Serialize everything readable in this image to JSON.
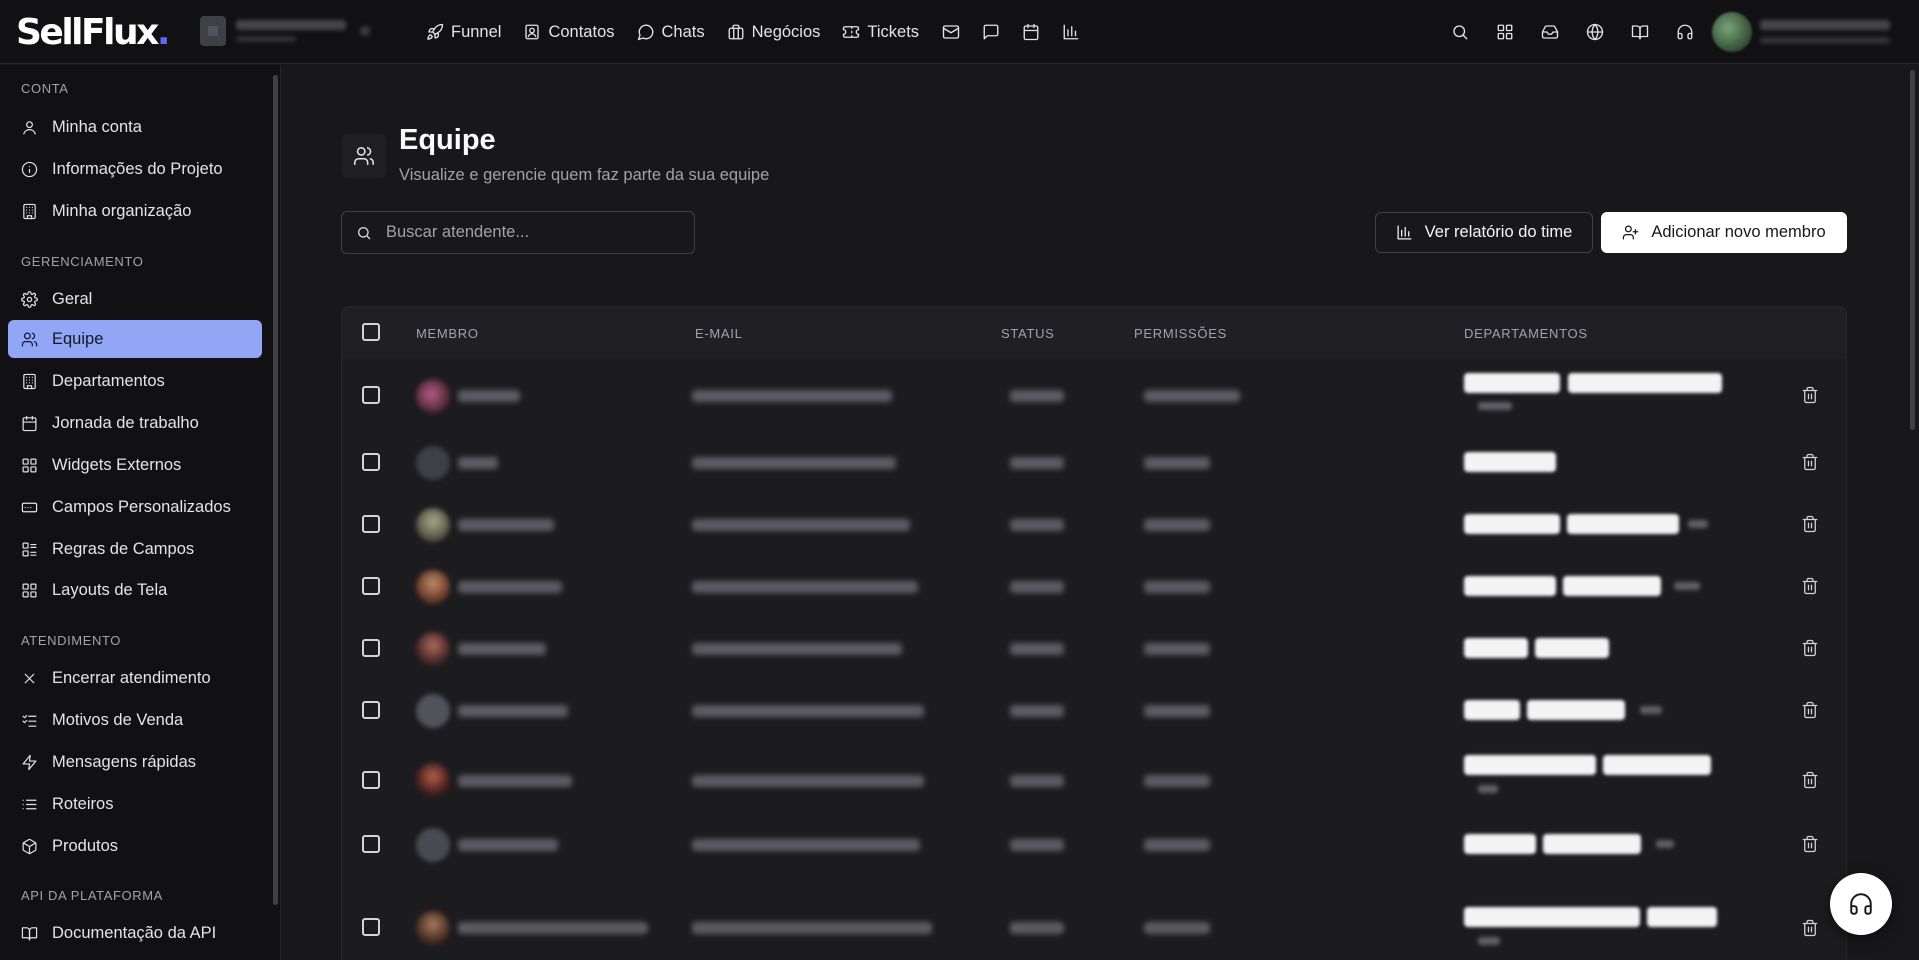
{
  "app": {
    "logo_text": "SellFlux",
    "logo_dot": ".",
    "accent": "#6366f1",
    "active_highlight": "#93a5f5"
  },
  "topnav": {
    "items": [
      {
        "label": "Funnel",
        "icon": "rocket-icon"
      },
      {
        "label": "Contatos",
        "icon": "contact-icon"
      },
      {
        "label": "Chats",
        "icon": "chat-icon"
      },
      {
        "label": "Negócios",
        "icon": "briefcase-icon"
      },
      {
        "label": "Tickets",
        "icon": "ticket-icon"
      }
    ],
    "icon_buttons": [
      "mail-icon",
      "message-icon",
      "calendar-icon",
      "bar-chart-icon"
    ],
    "right_icons": [
      "search-icon",
      "apps-grid-icon",
      "inbox-icon",
      "globe-icon",
      "book-icon",
      "headset-icon"
    ]
  },
  "sidebar": {
    "sections": [
      {
        "title": "CONTA",
        "items": [
          {
            "label": "Minha conta",
            "icon": "user-icon"
          },
          {
            "label": "Informações do Projeto",
            "icon": "info-icon"
          },
          {
            "label": "Minha organização",
            "icon": "building-icon"
          }
        ]
      },
      {
        "title": "GERENCIAMENTO",
        "items": [
          {
            "label": "Geral",
            "icon": "gear-icon"
          },
          {
            "label": "Equipe",
            "icon": "users-icon",
            "active": true
          },
          {
            "label": "Departamentos",
            "icon": "building-icon"
          },
          {
            "label": "Jornada de trabalho",
            "icon": "calendar-icon"
          },
          {
            "label": "Widgets Externos",
            "icon": "grid-icon"
          },
          {
            "label": "Campos Personalizados",
            "icon": "input-field-icon"
          },
          {
            "label": "Regras de Campos",
            "icon": "rules-icon"
          },
          {
            "label": "Layouts de Tela",
            "icon": "layout-icon"
          }
        ]
      },
      {
        "title": "ATENDIMENTO",
        "items": [
          {
            "label": "Encerrar atendimento",
            "icon": "close-icon"
          },
          {
            "label": "Motivos de Venda",
            "icon": "checklist-icon"
          },
          {
            "label": "Mensagens rápidas",
            "icon": "zap-icon"
          },
          {
            "label": "Roteiros",
            "icon": "list-icon"
          },
          {
            "label": "Produtos",
            "icon": "box-icon"
          }
        ]
      },
      {
        "title": "API DA PLATAFORMA",
        "items": [
          {
            "label": "Documentação da API",
            "icon": "book-icon"
          }
        ]
      }
    ]
  },
  "page": {
    "title": "Equipe",
    "subtitle": "Visualize e gerencie quem faz parte da sua equipe",
    "search_placeholder": "Buscar atendente...",
    "report_button": "Ver relatório do time",
    "add_button": "Adicionar novo membro"
  },
  "table": {
    "columns": [
      "MEMBRO",
      "E-MAIL",
      "STATUS",
      "PERMISSÕES",
      "DEPARTAMENTOS"
    ],
    "rows_visible": 9
  }
}
